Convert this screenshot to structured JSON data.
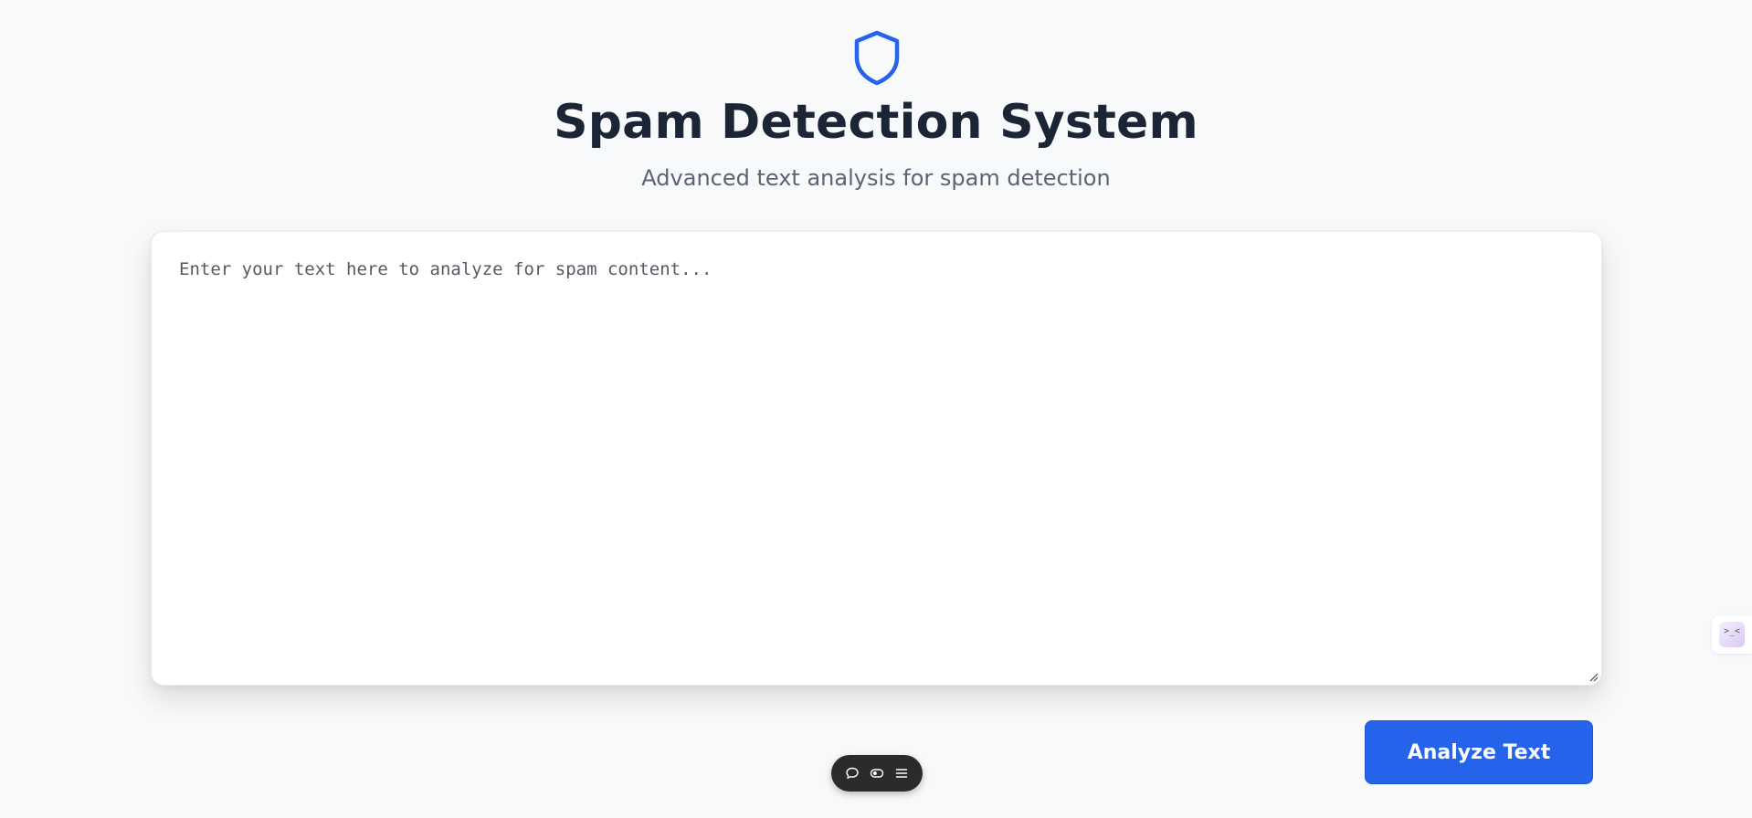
{
  "header": {
    "icon": "shield-icon",
    "title": "Spam Detection System",
    "subtitle": "Advanced text analysis for spam detection"
  },
  "editor": {
    "placeholder": "Enter your text here to analyze for spam content...",
    "value": ""
  },
  "actions": {
    "analyze_label": "Analyze Text"
  },
  "toolbar": {
    "icons": [
      "comment-icon",
      "toggle-icon",
      "menu-icon"
    ]
  },
  "side_widget": {
    "face_text": ">_<"
  },
  "colors": {
    "accent": "#2563eb",
    "background": "#f8f9fb",
    "title": "#1c2536",
    "subtitle": "#5b6474"
  }
}
